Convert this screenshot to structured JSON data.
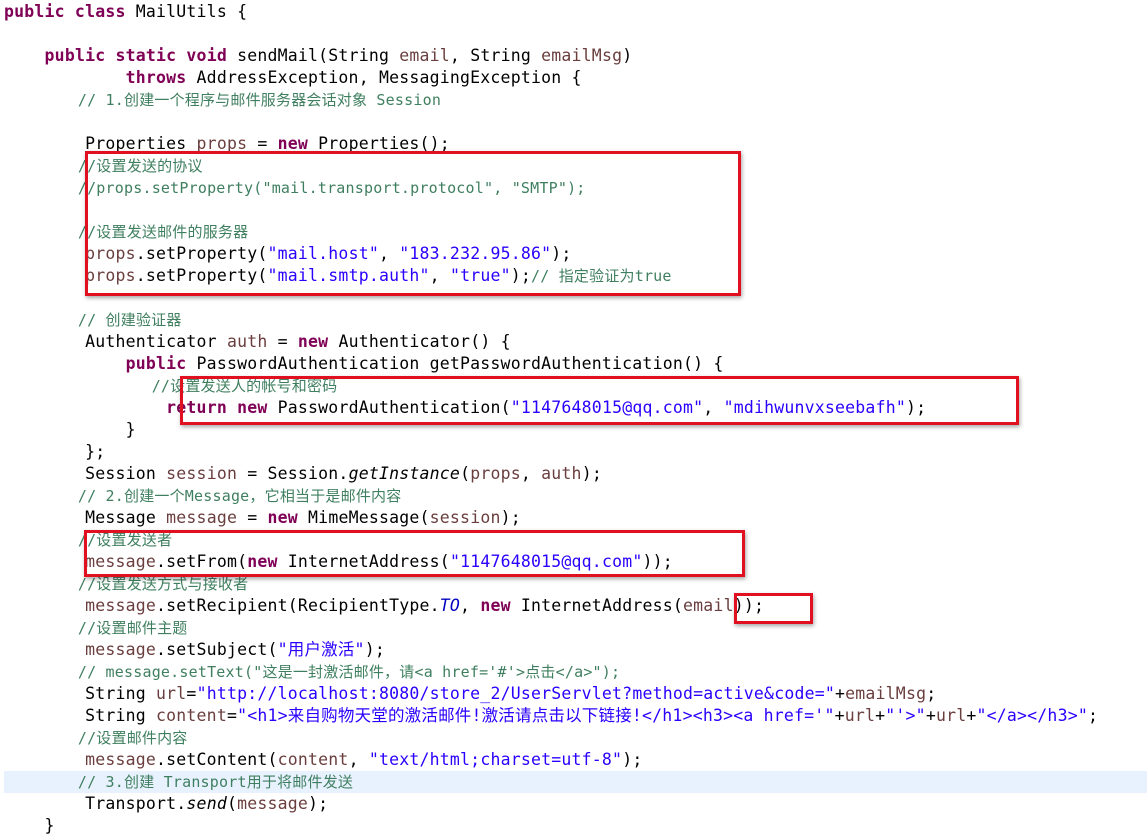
{
  "editor": {
    "lines": [
      [
        {
          "t": "public class ",
          "c": "kw"
        },
        {
          "t": "MailUtils {",
          "c": "pl"
        }
      ],
      [],
      [
        {
          "t": "    ",
          "c": "pl"
        },
        {
          "t": "public static void ",
          "c": "kw"
        },
        {
          "t": "sendMail(String ",
          "c": "pl"
        },
        {
          "t": "email",
          "c": "lv"
        },
        {
          "t": ", String ",
          "c": "pl"
        },
        {
          "t": "emailMsg",
          "c": "lv"
        },
        {
          "t": ")",
          "c": "pl"
        }
      ],
      [
        {
          "t": "            ",
          "c": "pl"
        },
        {
          "t": "throws ",
          "c": "kw"
        },
        {
          "t": "AddressException, MessagingException {",
          "c": "pl"
        }
      ],
      [
        {
          "t": "        // 1.创建一个程序与邮件服务器会话对象 Session",
          "c": "cm"
        }
      ],
      [],
      [
        {
          "t": "        Properties ",
          "c": "pl"
        },
        {
          "t": "props",
          "c": "lv"
        },
        {
          "t": " = ",
          "c": "pl"
        },
        {
          "t": "new ",
          "c": "kw"
        },
        {
          "t": "Properties();",
          "c": "pl"
        }
      ],
      [
        {
          "t": "        //设置发送的协议",
          "c": "cm"
        }
      ],
      [
        {
          "t": "        //props.setProperty(\"mail.transport.protocol\", \"SMTP\");",
          "c": "cm"
        }
      ],
      [],
      [
        {
          "t": "        //设置发送邮件的服务器",
          "c": "cm"
        }
      ],
      [
        {
          "t": "        ",
          "c": "pl"
        },
        {
          "t": "props",
          "c": "lv"
        },
        {
          "t": ".setProperty(",
          "c": "pl"
        },
        {
          "t": "\"mail.host\"",
          "c": "st"
        },
        {
          "t": ", ",
          "c": "pl"
        },
        {
          "t": "\"183.232.95.86\"",
          "c": "st"
        },
        {
          "t": ");",
          "c": "pl"
        }
      ],
      [
        {
          "t": "        ",
          "c": "pl"
        },
        {
          "t": "props",
          "c": "lv"
        },
        {
          "t": ".setProperty(",
          "c": "pl"
        },
        {
          "t": "\"mail.smtp.auth\"",
          "c": "st"
        },
        {
          "t": ", ",
          "c": "pl"
        },
        {
          "t": "\"true\"",
          "c": "st"
        },
        {
          "t": ");",
          "c": "pl"
        },
        {
          "t": "// 指定验证为true",
          "c": "cm"
        }
      ],
      [],
      [
        {
          "t": "        // 创建验证器",
          "c": "cm"
        }
      ],
      [
        {
          "t": "        Authenticator ",
          "c": "pl"
        },
        {
          "t": "auth",
          "c": "lv"
        },
        {
          "t": " = ",
          "c": "pl"
        },
        {
          "t": "new ",
          "c": "kw"
        },
        {
          "t": "Authenticator() {",
          "c": "pl"
        }
      ],
      [
        {
          "t": "            ",
          "c": "pl"
        },
        {
          "t": "public ",
          "c": "kw"
        },
        {
          "t": "PasswordAuthentication getPasswordAuthentication() {",
          "c": "pl"
        }
      ],
      [
        {
          "t": "                //设置发送人的帐号和密码",
          "c": "cm"
        }
      ],
      [
        {
          "t": "                ",
          "c": "pl"
        },
        {
          "t": "return new ",
          "c": "kw"
        },
        {
          "t": "PasswordAuthentication(",
          "c": "pl"
        },
        {
          "t": "\"1147648015@qq.com\"",
          "c": "st"
        },
        {
          "t": ", ",
          "c": "pl"
        },
        {
          "t": "\"mdihwunvxseebafh\"",
          "c": "st"
        },
        {
          "t": ");",
          "c": "pl"
        }
      ],
      [
        {
          "t": "            }",
          "c": "pl"
        }
      ],
      [
        {
          "t": "        };",
          "c": "pl"
        }
      ],
      [
        {
          "t": "        Session ",
          "c": "pl"
        },
        {
          "t": "session",
          "c": "lv"
        },
        {
          "t": " = Session.",
          "c": "pl"
        },
        {
          "t": "getInstance",
          "c": "it"
        },
        {
          "t": "(",
          "c": "pl"
        },
        {
          "t": "props",
          "c": "lv"
        },
        {
          "t": ", ",
          "c": "pl"
        },
        {
          "t": "auth",
          "c": "lv"
        },
        {
          "t": ");",
          "c": "pl"
        }
      ],
      [
        {
          "t": "        // 2.创建一个Message，它相当于是邮件内容",
          "c": "cm"
        }
      ],
      [
        {
          "t": "        Message ",
          "c": "pl"
        },
        {
          "t": "message",
          "c": "lv"
        },
        {
          "t": " = ",
          "c": "pl"
        },
        {
          "t": "new ",
          "c": "kw"
        },
        {
          "t": "MimeMessage(",
          "c": "pl"
        },
        {
          "t": "session",
          "c": "lv"
        },
        {
          "t": ");",
          "c": "pl"
        }
      ],
      [
        {
          "t": "        //设置发送者",
          "c": "cm"
        }
      ],
      [
        {
          "t": "        ",
          "c": "pl"
        },
        {
          "t": "message",
          "c": "lv"
        },
        {
          "t": ".setFrom(",
          "c": "pl"
        },
        {
          "t": "new ",
          "c": "kw"
        },
        {
          "t": "InternetAddress(",
          "c": "pl"
        },
        {
          "t": "\"1147648015@qq.com\"",
          "c": "st"
        },
        {
          "t": "));",
          "c": "pl"
        }
      ],
      [
        {
          "t": "        //设置发送方式与接收者",
          "c": "cm"
        }
      ],
      [
        {
          "t": "        ",
          "c": "pl"
        },
        {
          "t": "message",
          "c": "lv"
        },
        {
          "t": ".setRecipient(RecipientType.",
          "c": "pl"
        },
        {
          "t": "TO",
          "c": "fd"
        },
        {
          "t": ", ",
          "c": "pl"
        },
        {
          "t": "new ",
          "c": "kw"
        },
        {
          "t": "InternetAddress(",
          "c": "pl"
        },
        {
          "t": "email",
          "c": "lv"
        },
        {
          "t": "));",
          "c": "pl"
        }
      ],
      [
        {
          "t": "        //设置邮件主题",
          "c": "cm"
        }
      ],
      [
        {
          "t": "        ",
          "c": "pl"
        },
        {
          "t": "message",
          "c": "lv"
        },
        {
          "t": ".setSubject(",
          "c": "pl"
        },
        {
          "t": "\"用户激活\"",
          "c": "st"
        },
        {
          "t": ");",
          "c": "pl"
        }
      ],
      [
        {
          "t": "        // message.setText(\"这是一封激活邮件，请<a href='#'>点击</a>\");",
          "c": "cm"
        }
      ],
      [
        {
          "t": "        String ",
          "c": "pl"
        },
        {
          "t": "url",
          "c": "lv"
        },
        {
          "t": "=",
          "c": "pl"
        },
        {
          "t": "\"http://localhost:8080/store_2/UserServlet?method=active&code=\"",
          "c": "st"
        },
        {
          "t": "+",
          "c": "pl"
        },
        {
          "t": "emailMsg",
          "c": "lv"
        },
        {
          "t": ";",
          "c": "pl"
        }
      ],
      [
        {
          "t": "        String ",
          "c": "pl"
        },
        {
          "t": "content",
          "c": "lv"
        },
        {
          "t": "=",
          "c": "pl"
        },
        {
          "t": "\"<h1>来自购物天堂的激活邮件!激活请点击以下链接!</h1><h3><a href='\"",
          "c": "st"
        },
        {
          "t": "+",
          "c": "pl"
        },
        {
          "t": "url",
          "c": "lv"
        },
        {
          "t": "+",
          "c": "pl"
        },
        {
          "t": "\"'>\"",
          "c": "st"
        },
        {
          "t": "+",
          "c": "pl"
        },
        {
          "t": "url",
          "c": "lv"
        },
        {
          "t": "+",
          "c": "pl"
        },
        {
          "t": "\"</a></h3>\"",
          "c": "st"
        },
        {
          "t": ";",
          "c": "pl"
        }
      ],
      [
        {
          "t": "        //设置邮件内容",
          "c": "cm"
        }
      ],
      [
        {
          "t": "        ",
          "c": "pl"
        },
        {
          "t": "message",
          "c": "lv"
        },
        {
          "t": ".setContent(",
          "c": "pl"
        },
        {
          "t": "content",
          "c": "lv"
        },
        {
          "t": ", ",
          "c": "pl"
        },
        {
          "t": "\"text/html;charset=utf-8\"",
          "c": "st"
        },
        {
          "t": ");",
          "c": "pl"
        }
      ],
      [
        {
          "t": "        // 3.创建 Transport用于将邮件发送",
          "c": "cm"
        }
      ],
      [
        {
          "t": "        Transport.",
          "c": "pl"
        },
        {
          "t": "send",
          "c": "it"
        },
        {
          "t": "(",
          "c": "pl"
        },
        {
          "t": "message",
          "c": "lv"
        },
        {
          "t": ");",
          "c": "pl"
        }
      ],
      [
        {
          "t": "    }",
          "c": "pl"
        }
      ]
    ],
    "highlighted_line": 35
  }
}
